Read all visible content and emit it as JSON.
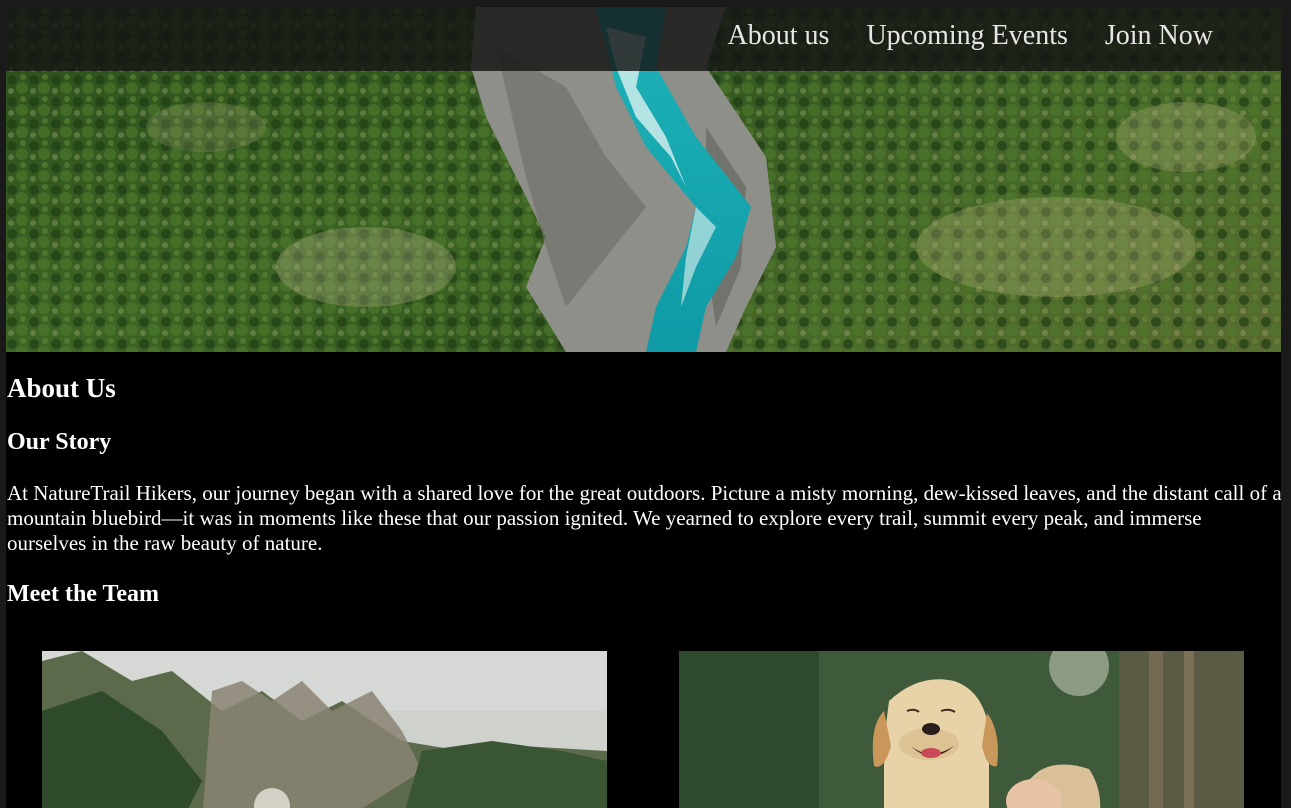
{
  "nav": {
    "items": [
      {
        "label": "About us"
      },
      {
        "label": "Upcoming Events"
      },
      {
        "label": "Join Now"
      }
    ]
  },
  "hero": {
    "image": "aerial-river-forest"
  },
  "about": {
    "title": "About Us",
    "story_heading": "Our Story",
    "story_text": "At NatureTrail Hikers, our journey began with a shared love for the great outdoors. Picture a misty morning, dew-kissed leaves, and the distant call of a mountain bluebird—it was in moments like these that our passion ignited. We yearned to explore every trail, summit every peak, and immerse ourselves in the raw beauty of nature.",
    "team_heading": "Meet the Team"
  },
  "team": {
    "photos": [
      {
        "image": "hiker-outdoors-trees"
      },
      {
        "image": "smiling-labrador-with-person"
      }
    ]
  },
  "colors": {
    "background": "#000000",
    "text": "#ffffff",
    "nav_text": "#e6e6e6"
  }
}
